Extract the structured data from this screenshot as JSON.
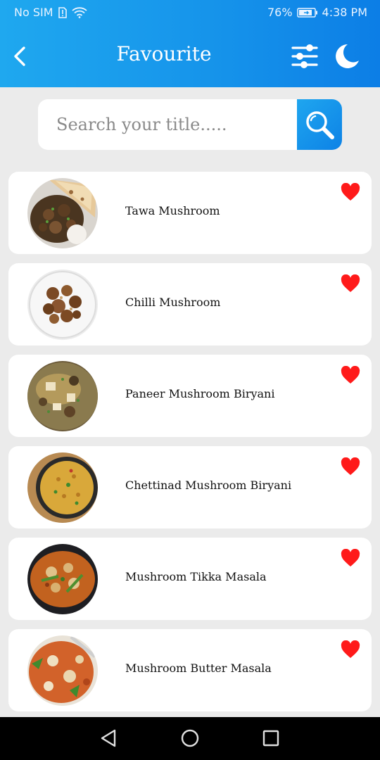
{
  "status_bar": {
    "carrier": "No SIM",
    "battery": "76%",
    "time": "4:38 PM"
  },
  "app_bar": {
    "title": "Favourite",
    "icons": [
      "back-arrow-icon",
      "filter-sliders-icon",
      "moon-icon"
    ]
  },
  "search": {
    "placeholder": "Search your title.....",
    "value": ""
  },
  "favourites": [
    {
      "title": "Tawa Mushroom",
      "image": "tawa-mushroom-dish",
      "favourite": true
    },
    {
      "title": "Chilli Mushroom",
      "image": "chilli-mushroom-dish",
      "favourite": true
    },
    {
      "title": "Paneer Mushroom Biryani",
      "image": "paneer-mushroom-biryani-dish",
      "favourite": true
    },
    {
      "title": "Chettinad Mushroom Biryani",
      "image": "chettinad-mushroom-biryani-dish",
      "favourite": true
    },
    {
      "title": "Mushroom Tikka Masala",
      "image": "mushroom-tikka-masala-dish",
      "favourite": true
    },
    {
      "title": "Mushroom Butter Masala",
      "image": "mushroom-butter-masala-dish",
      "favourite": true
    }
  ],
  "colors": {
    "header_start": "#1fa8ef",
    "header_end": "#0c7ee6",
    "heart": "#ff1a1a",
    "background": "#ebebeb"
  },
  "nav_bar": {
    "icons": [
      "back-triangle-icon",
      "home-circle-icon",
      "recents-square-icon"
    ]
  }
}
